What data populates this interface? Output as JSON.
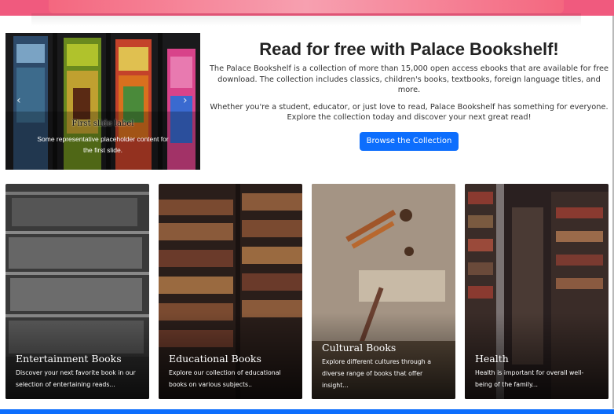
{
  "carousel": {
    "slide_title": "First slide label",
    "slide_text": "Some representative placeholder content for the first slide.",
    "prev_icon": "chevron-left-icon",
    "next_icon": "chevron-right-icon",
    "indicators": 3
  },
  "hero": {
    "title": "Read for free with Palace Bookshelf!",
    "paragraph_1": "The Palace Bookshelf is a collection of more than 15,000 open access ebooks that are available for free download. The collection includes classics, children's books, textbooks, foreign language titles, and more.",
    "paragraph_2": "Whether you're a student, educator, or just love to read, Palace Bookshelf has something for everyone. Explore the collection today and discover your next great read!",
    "button_label": "Browse the Collection"
  },
  "categories": [
    {
      "title": "Entertainment Books",
      "text": "Discover your next favorite book in our selection of entertaining reads..."
    },
    {
      "title": "Educational Books",
      "text": "Explore our collection of educational books on various subjects.."
    },
    {
      "title": "Cultural Books",
      "text": "Explore different cultures through a diverse range of books that offer insight..."
    },
    {
      "title": "Health",
      "text": "Health is important for overall well-being of the family..."
    }
  ],
  "colors": {
    "primary": "#0d6efd",
    "banner": "#f05a7e"
  }
}
